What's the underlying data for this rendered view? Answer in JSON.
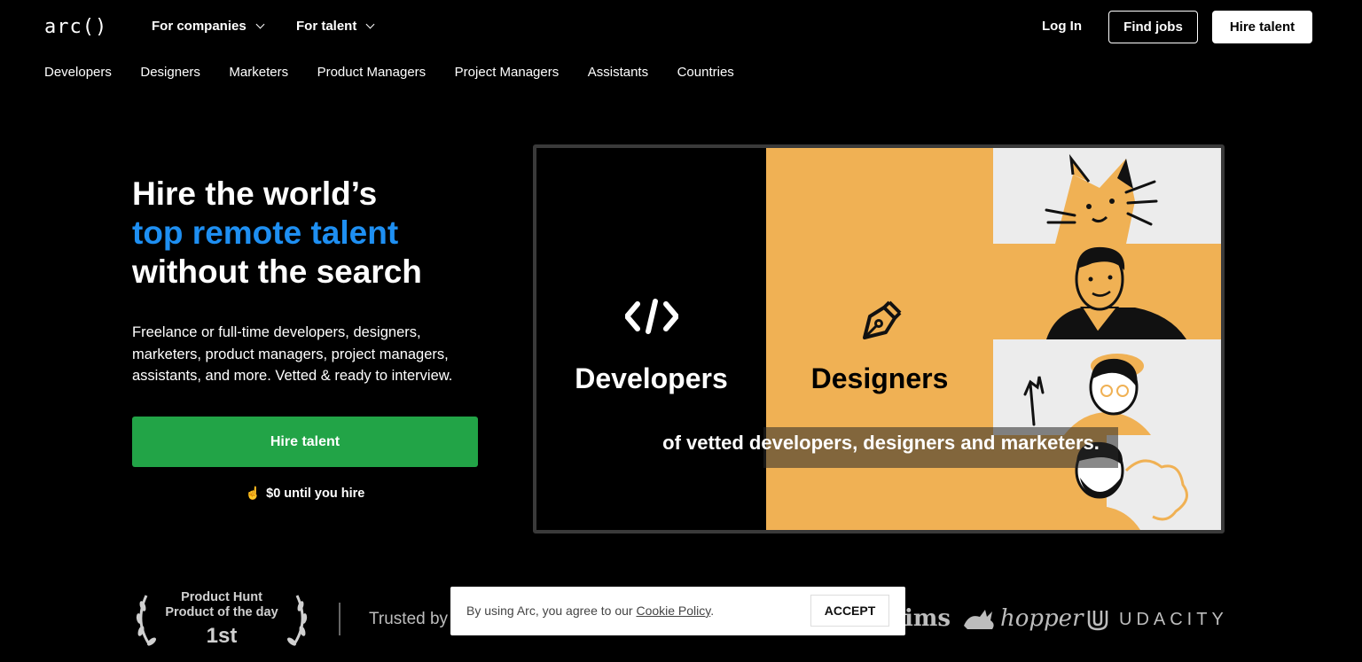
{
  "header": {
    "logo": "arc()",
    "nav": [
      {
        "label": "For companies"
      },
      {
        "label": "For talent"
      }
    ],
    "login": "Log In",
    "find_jobs": "Find jobs",
    "hire_talent": "Hire talent"
  },
  "subnav": [
    "Developers",
    "Designers",
    "Marketers",
    "Product Managers",
    "Project Managers",
    "Assistants",
    "Countries"
  ],
  "hero": {
    "title_line1": "Hire the world’s",
    "title_line2": "top remote talent",
    "title_line3": "without the search",
    "description": "Freelance or full-time developers, designers, marketers, product managers, project managers, assistants, and more. Vetted & ready to interview.",
    "cta": "Hire talent",
    "note": "$0 until you hire",
    "accent_color": "#1e8ff2",
    "cta_color": "#22a447"
  },
  "media": {
    "developers_label": "Developers",
    "designers_label": "Designers",
    "caption": "of vetted developers, designers and marketers.",
    "panel_color": "#f0b154"
  },
  "badge": {
    "line1": "Product Hunt",
    "line2": "Product of the day",
    "line3": "1st"
  },
  "trusted": {
    "label": "Trusted by",
    "brands": [
      "ims",
      "hopper",
      "UDACITY"
    ]
  },
  "cookie": {
    "text": "By using Arc, you agree to our ",
    "link": "Cookie Policy",
    "suffix": ".",
    "accept": "ACCEPT"
  }
}
